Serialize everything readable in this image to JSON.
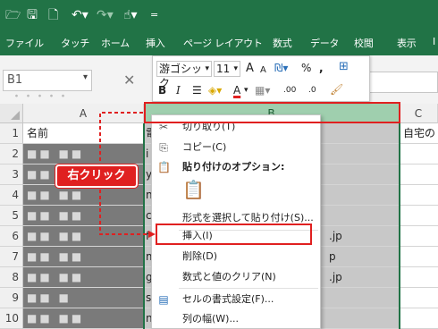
{
  "title_bar": {
    "icons": [
      "folder-icon",
      "save-icon",
      "print-preview-icon",
      "undo-icon",
      "redo-icon",
      "touch-mode-icon",
      "customize-icon"
    ]
  },
  "ribbon_tabs": [
    "ファイル",
    "タッチ",
    "ホーム",
    "挿入",
    "ページ レイアウト",
    "数式",
    "データ",
    "校閲",
    "表示",
    "I"
  ],
  "name_box": {
    "value": "B1",
    "blurred_text": "・・・・・"
  },
  "mini_toolbar": {
    "font": "游ゴシック",
    "size": "11",
    "grow_font": "A",
    "shrink_font": "A",
    "percent": "%",
    "comma": ",",
    "bold": "B",
    "italic": "I",
    "font_color": "A",
    "inc_decimal": ".00",
    "dec_decimal": ".0"
  },
  "columns": {
    "a": "A",
    "b": "B",
    "c": "C"
  },
  "rows": [
    {
      "num": "1",
      "a": "名前",
      "b": "",
      "c": "自宅の"
    },
    {
      "num": "2",
      "a": "■■ ■■",
      "b": "",
      "c": ""
    },
    {
      "num": "3",
      "a": "■■ ■■",
      "b": "",
      "c": ""
    },
    {
      "num": "4",
      "a": "■■ ■■",
      "b": "",
      "c": ""
    },
    {
      "num": "5",
      "a": "■■ ■■",
      "b": "",
      "c": ""
    },
    {
      "num": "6",
      "a": "■■ ■■",
      "b": ".jp",
      "c": ""
    },
    {
      "num": "7",
      "a": "■■ ■■",
      "b": "p",
      "c": ""
    },
    {
      "num": "8",
      "a": "■■ ■■",
      "b": ".jp",
      "c": ""
    },
    {
      "num": "9",
      "a": "■■ ■",
      "b": "",
      "c": ""
    },
    {
      "num": "10",
      "a": "■■ ■■",
      "b": "",
      "c": ""
    }
  ],
  "col_b_leading": [
    "電",
    "i",
    "y",
    "n",
    "c",
    "f",
    "m",
    "g",
    "s",
    "n"
  ],
  "context_menu": {
    "cut": "切り取り(T)",
    "copy": "コピー(C)",
    "paste_options": "貼り付けのオプション:",
    "paste_special": "形式を選択して貼り付け(S)...",
    "insert": "挿入(I)",
    "delete": "削除(D)",
    "clear": "数式と値のクリア(N)",
    "format_cells": "セルの書式設定(F)...",
    "column_width": "列の幅(W)..."
  },
  "annotation": {
    "label": "右クリック",
    "color": "#e02020"
  },
  "colors": {
    "excel_green": "#217346",
    "selected_header": "#9fcfae"
  }
}
